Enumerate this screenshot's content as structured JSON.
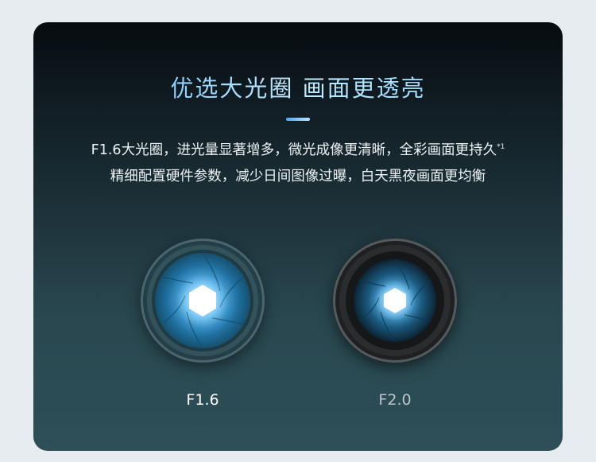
{
  "headline": "优选大光圈 画面更透亮",
  "description": {
    "line1": "F1.6大光圈，进光量显著增多，微光成像更清晰，全彩画面更持久",
    "line1_note": "*1",
    "line2": "精细配置硬件参数，减少日间图像过曝，白天黑夜画面更均衡"
  },
  "lenses": [
    {
      "label": "F1.6",
      "aperture_icon": "aperture-icon"
    },
    {
      "label": "F2.0",
      "aperture_icon": "aperture-icon"
    }
  ],
  "colors": {
    "headline": "#8fd6ff",
    "accent": "#4fa8ff",
    "iris_blue": "#2a8fd0",
    "card_top": "#060b0f",
    "card_bottom": "#2e4f58"
  }
}
